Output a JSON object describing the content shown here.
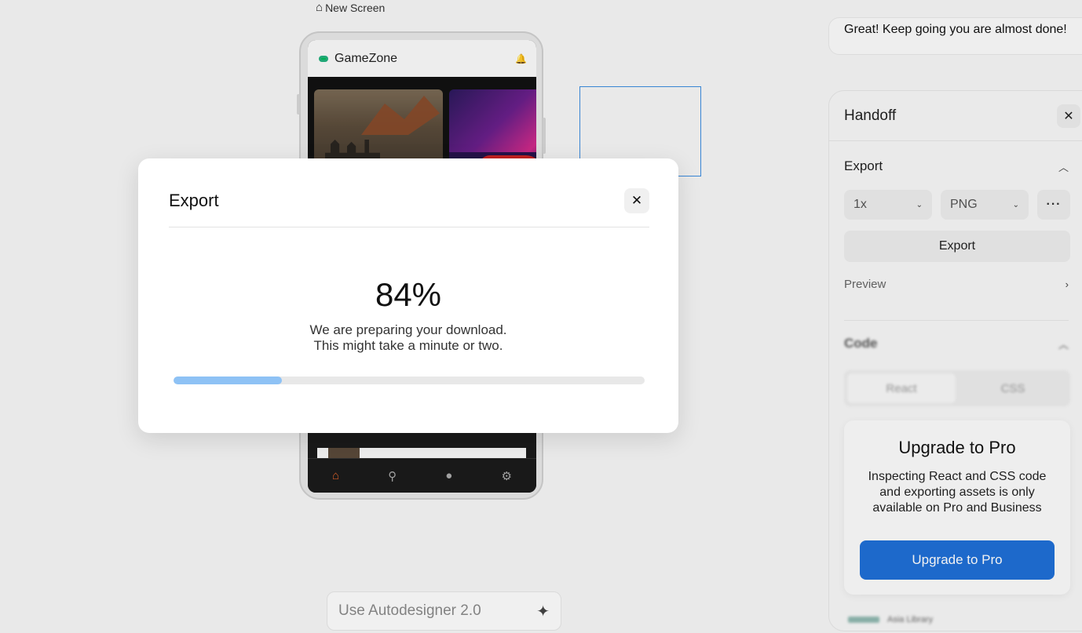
{
  "canvas": {
    "screen_label": "New Screen",
    "app": {
      "title": "GameZone",
      "nav_icons": [
        "home-icon",
        "search-icon",
        "profile-icon",
        "settings-icon"
      ]
    },
    "autodesigner_placeholder": "Use Autodesigner 2.0"
  },
  "toast": {
    "message": "Great! Keep going you are almost done!"
  },
  "handoff": {
    "title": "Handoff",
    "export_section": {
      "label": "Export",
      "scale": "1x",
      "format": "PNG",
      "export_button": "Export",
      "preview_label": "Preview"
    },
    "code_section": {
      "label": "Code",
      "tabs": [
        "React",
        "CSS"
      ]
    },
    "upgrade": {
      "title": "Upgrade to Pro",
      "description": "Inspecting React and CSS code and exporting assets is only available on Pro and Business",
      "button": "Upgrade to Pro"
    },
    "footer_text": "Asia Library"
  },
  "export_modal": {
    "title": "Export",
    "percent_text": "84%",
    "message_line1": "We are preparing your download.",
    "message_line2": "This might take a minute or two.",
    "progress_fraction": 0.23
  },
  "colors": {
    "accent_blue": "#1f6fd6",
    "progress_fill": "#8ec2f5",
    "nav_active": "#e0622a",
    "selection": "#3b8de0"
  }
}
